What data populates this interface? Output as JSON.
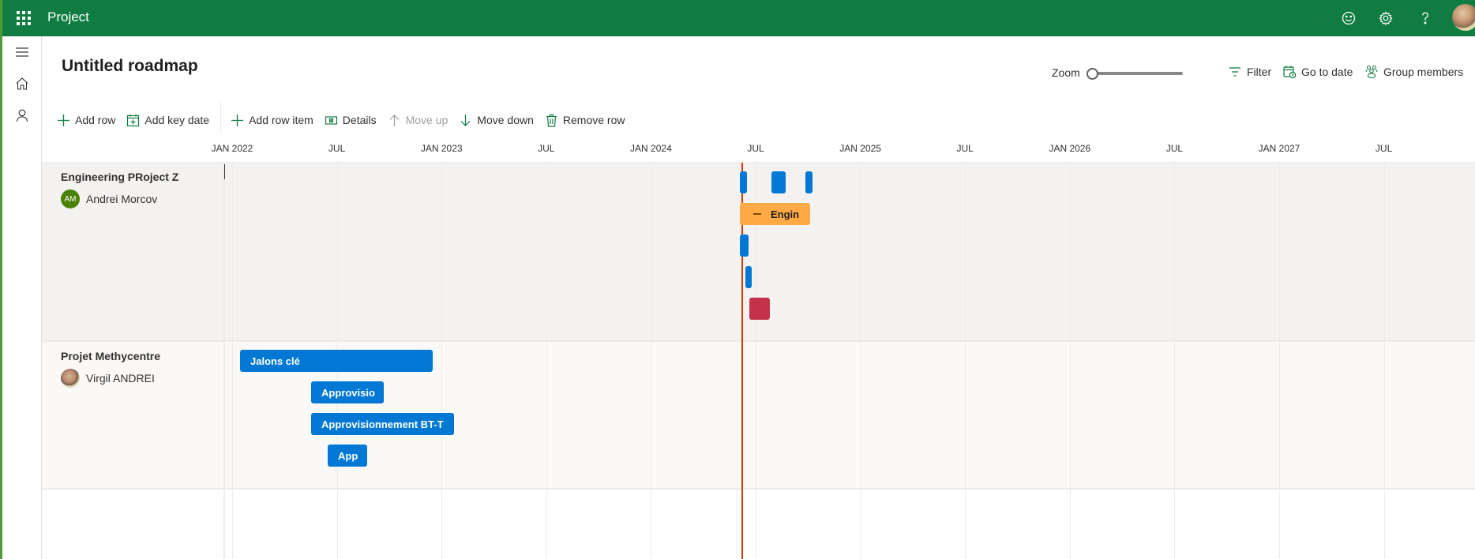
{
  "app": {
    "title": "Project",
    "header_icons": [
      "feedback-smiley-icon",
      "settings-gear-icon",
      "help-question-icon",
      "user-avatar"
    ]
  },
  "sidebar": {
    "items": [
      {
        "icon": "hamburger-menu-icon",
        "label": "Collapse navigation"
      },
      {
        "icon": "home-icon",
        "label": "Home"
      },
      {
        "icon": "person-icon",
        "label": "Me"
      }
    ]
  },
  "page": {
    "title": "Untitled roadmap"
  },
  "zoom": {
    "label": "Zoom",
    "value_fraction": 0
  },
  "commands": {
    "filter": "Filter",
    "go_to_date": "Go to date",
    "group_members": "Group members"
  },
  "toolbar": {
    "add_row": "Add row",
    "add_key_date": "Add key date",
    "add_row_item": "Add row item",
    "details": "Details",
    "move_up": "Move up",
    "move_down": "Move down",
    "remove_row": "Remove row"
  },
  "timeline": {
    "start": "2022-01",
    "ticks": [
      "JAN 2022",
      "JUL",
      "JAN 2023",
      "JUL",
      "JAN 2024",
      "JUL",
      "JAN 2025",
      "JUL",
      "JAN 2026",
      "JUL",
      "JAN 2027",
      "JUL"
    ],
    "today": "2024-06"
  },
  "colors": {
    "brand": "#107c41",
    "bar_blue": "#0078d4",
    "bar_orange": "#ffaa44",
    "bar_red": "#c4314b",
    "today_line": "#d83b01",
    "avatar_green": "#498205"
  },
  "rows": [
    {
      "name": "Engineering PRoject Z",
      "owner": "Andrei Morcov",
      "owner_initials": "AM",
      "items": [
        {
          "label": "",
          "color": "blue"
        },
        {
          "label": "",
          "color": "blue"
        },
        {
          "label": "",
          "color": "blue"
        },
        {
          "label": "Engin",
          "color": "orange",
          "type": "group"
        },
        {
          "label": "",
          "color": "blue"
        },
        {
          "label": "",
          "color": "blue"
        },
        {
          "label": "",
          "color": "red"
        }
      ]
    },
    {
      "name": "Projet Methycentre",
      "owner": "Virgil ANDREI",
      "items": [
        {
          "label": "Jalons clé",
          "color": "blue"
        },
        {
          "label": "Approvisio",
          "color": "blue"
        },
        {
          "label": "Approvisionnement BT-T",
          "color": "blue"
        },
        {
          "label": "App",
          "color": "blue"
        }
      ]
    }
  ]
}
